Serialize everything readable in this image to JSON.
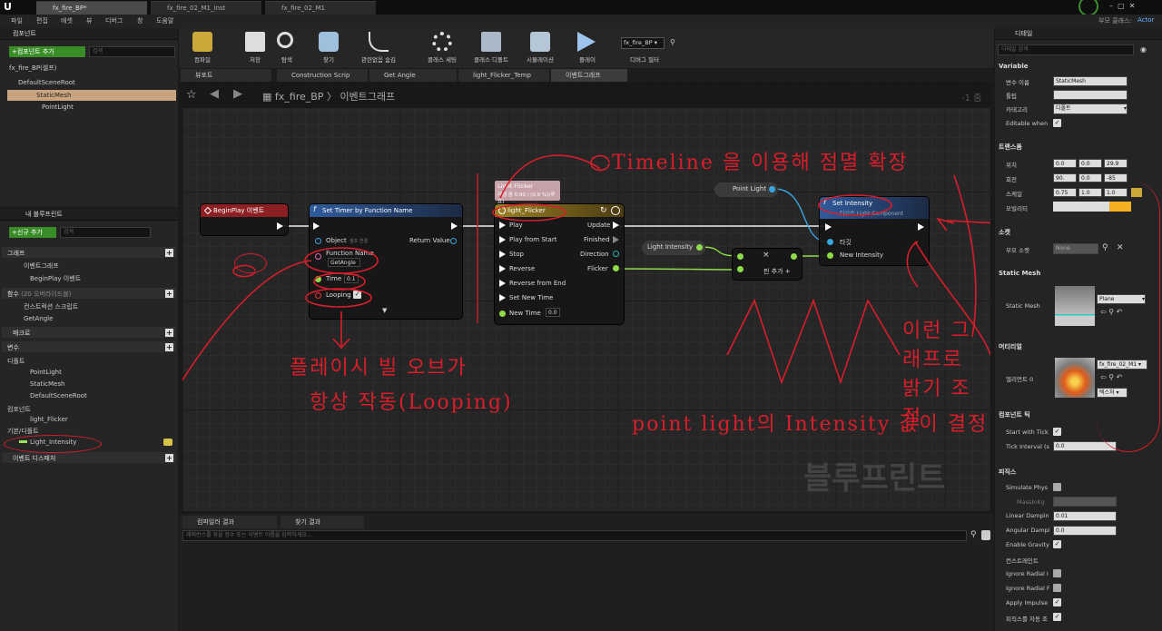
{
  "tabs": [
    "fx_fire_BP*",
    "fx_fire_02_M1_Inst",
    "fx_fire_02_M1"
  ],
  "menu": [
    "파일",
    "편집",
    "에셋",
    "뷰",
    "디버그",
    "창",
    "도움말"
  ],
  "parent_class_label": "부모 클래스:",
  "parent_class_value": "Actor",
  "components": {
    "title": "컴포넌트",
    "add_label": "+컴포넌트 추가",
    "search_placeholder": "검색",
    "self_label": "fx_fire_BP(셀프)",
    "tree": [
      "DefaultSceneRoot",
      "StaticMesh",
      "PointLight"
    ]
  },
  "my_blueprint": {
    "title": "내 블루프린트",
    "add_label": "+신규 추가",
    "search_placeholder": "검색",
    "graphs_label": "그래프",
    "event_graph": "이벤트그래프",
    "begin_play": "BeginPlay 이벤트",
    "functions_label": "함수",
    "functions_count": "(20 오버라이드블)",
    "construction_script": "컨스트럭션 스크립트",
    "get_angle": "GetAngle",
    "macros_label": "매크로",
    "variables_label": "변수",
    "default_label": "디폴트",
    "vars": [
      "PointLight",
      "StaticMesh",
      "DefaultSceneRoot"
    ],
    "components_label": "컴포넌트",
    "light_flicker": "light_Flicker",
    "basic_default_label": "기본/디폴트",
    "light_intensity": "Light_Intensity",
    "event_dispatchers": "이벤트 디스패처"
  },
  "toolbar": [
    "컴파일",
    "저장",
    "탐색",
    "찾기",
    "관련없음 숨김",
    "클래스 세팅",
    "클래스 디폴트",
    "시뮬레이션",
    "플레이"
  ],
  "debug_selector": "fx_fire_BP",
  "debug_filter": "디버그 필터",
  "doc_tabs": [
    "뷰포트",
    "Construction Scrip",
    "Get Angle",
    "light_Flicker_Temp",
    "이벤트그래프"
  ],
  "breadcrumb": {
    "bp": "fx_fire_BP",
    "graph": "이벤트그래프"
  },
  "zoom": "-1 줌",
  "watermark": "블루프린트",
  "nodes": {
    "begin_play": "BeginPlay 이벤트",
    "set_timer": {
      "title": "Set Timer by Function Name",
      "object": "Object",
      "object_hint": "셀프 연결",
      "return": "Return Value",
      "fn_label": "Function Name",
      "fn_value": "GetAngle",
      "time_label": "Time",
      "time_value": "0.1",
      "looping_label": "Looping"
    },
    "timeline": {
      "comment_title": "Light Flicker",
      "comment_sub": "재생 중 0.00 / (0.0 %)(루프)",
      "title": "light_Flicker",
      "pins_in": [
        "Play",
        "Play from Start",
        "Stop",
        "Reverse",
        "Reverse from End",
        "Set New Time",
        "New Time"
      ],
      "new_time_value": "0.0",
      "pins_out": [
        "Update",
        "Finished",
        "Direction",
        "Flicker"
      ]
    },
    "point_light": "Point Light",
    "light_intensity": "Light Intensity",
    "multiply": {
      "symbol": "×",
      "add_pin": "핀 추가"
    },
    "set_intensity": {
      "title": "Set Intensity",
      "subtitle": "타깃은 Light Component",
      "target": "타깃",
      "new_intensity": "New Intensity"
    }
  },
  "bottom": {
    "tab1": "컴파일러 결과",
    "tab2": "찾기 결과",
    "placeholder": "레퍼런스를 찾을 함수 또는 이벤트 이름을 입력하세요..."
  },
  "details": {
    "title": "디테일",
    "search_placeholder": "디테일 검색",
    "variable_section": "Variable",
    "var_name_label": "변수 이름",
    "var_name": "StaticMesh",
    "tooltip_label": "툴팁",
    "category_label": "카테고리",
    "category": "디폴트",
    "editable_label": "Editable when",
    "transform_section": "트랜스폼",
    "location_label": "위치",
    "location": [
      "0.0",
      "0.0",
      "29.9"
    ],
    "rotation_label": "회전",
    "rotation": [
      "90.",
      "0.0",
      "-85"
    ],
    "scale_label": "스케일",
    "scale": [
      "0.75",
      "1.0",
      "1.0"
    ],
    "mobility_label": "모빌리티",
    "socket_section": "소켓",
    "parent_socket_label": "부모 소켓",
    "parent_socket": "None",
    "static_mesh_section": "Static Mesh",
    "static_mesh_label": "Static Mesh",
    "static_mesh": "Plane",
    "materials_section": "머티리얼",
    "element_label": "엘리먼트 0",
    "material": "fx_fire_02_M1",
    "texture_btn": "텍스처",
    "tick_section": "컴포넌트 틱",
    "start_tick_label": "Start with Tick",
    "tick_interval_label": "Tick Interval (s",
    "tick_interval": "0.0",
    "physics_section": "피직스",
    "simulate_label": "Simulate Phys",
    "mass_label": "MassInKg",
    "linear_label": "Linear Dampin",
    "linear": "0.01",
    "angular_label": "Angular Dampi",
    "angular": "0.0",
    "gravity_label": "Enable Gravity",
    "constraints_label": "컨스트레인트",
    "ignore_radial1": "Ignore Radial I",
    "ignore_radial2": "Ignore Radial F",
    "apply_impulse": "Apply Impulse",
    "physics_auto": "피직스를 자동 조"
  },
  "annotations": {
    "timeline": "Timeline 을 이용해 점멸 확장",
    "graph_control": "이런 그래프로 밝기 조절",
    "point_light": "point light의 Intensity 값이 결정",
    "flash": "플레이시 빌 오브가",
    "always": "항상 작동(Looping)"
  }
}
